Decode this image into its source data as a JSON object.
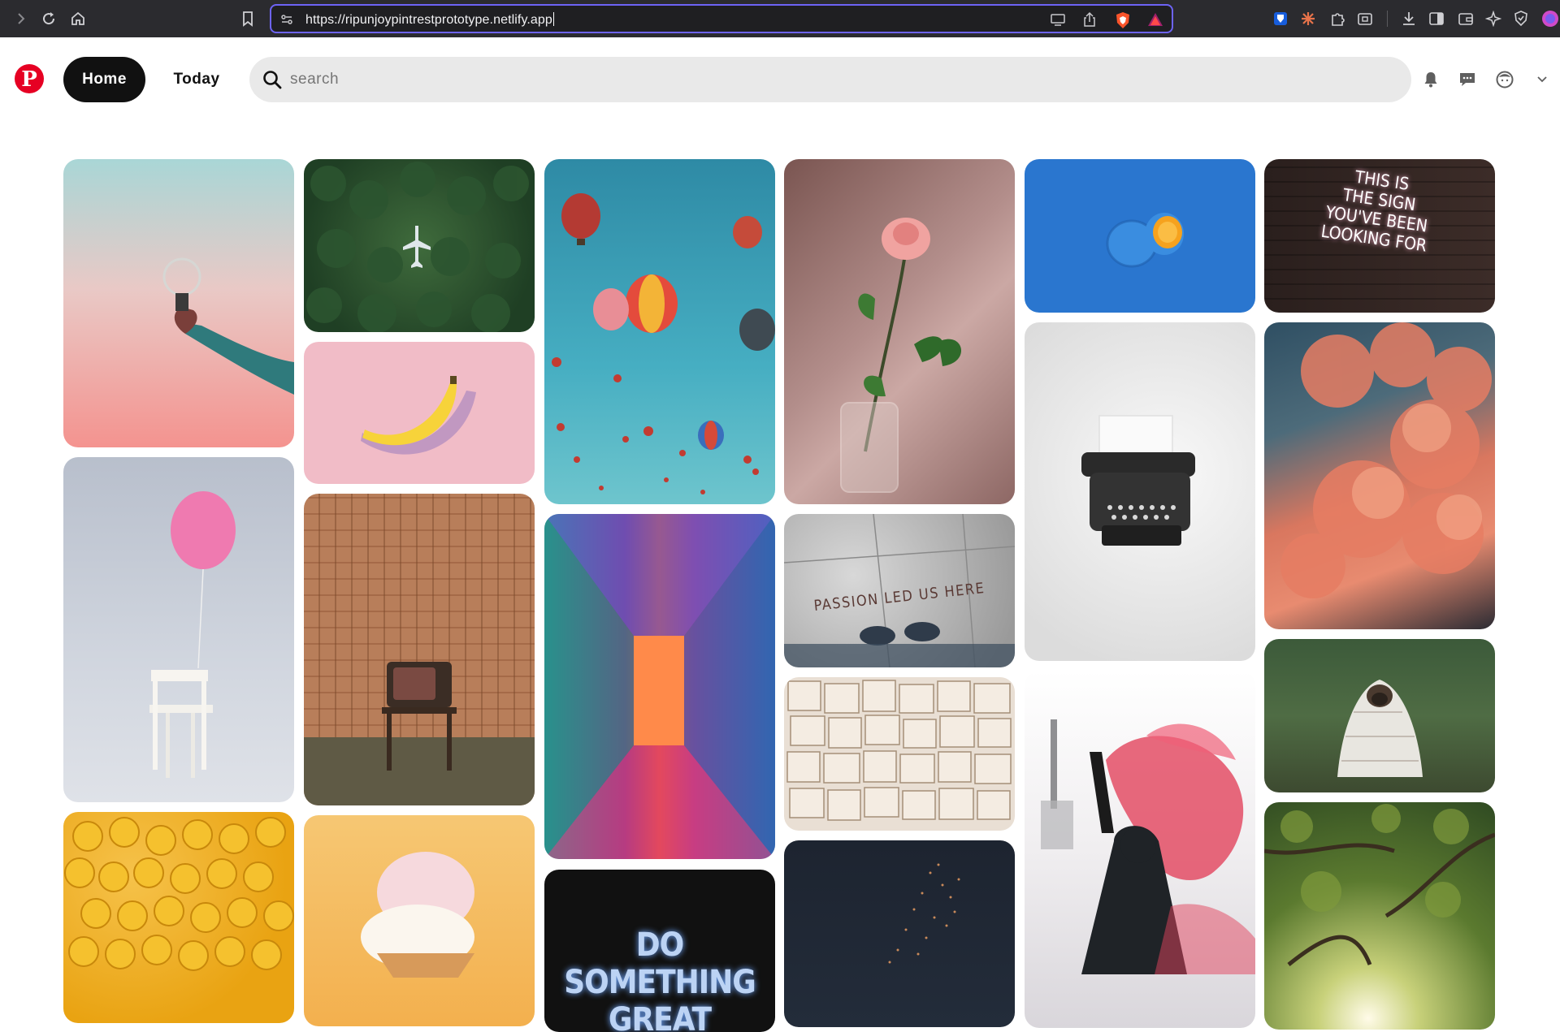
{
  "browser": {
    "url": "https://ripunjoypintrestprototype.netlify.app",
    "accent": "#6d63f5"
  },
  "header": {
    "logo_letter": "P",
    "logo_color": "#e60023",
    "home_label": "Home",
    "today_label": "Today",
    "search_placeholder": "search",
    "icons": [
      "bell-icon",
      "message-icon",
      "profile-icon",
      "chevron-down-icon"
    ]
  },
  "pins": [
    {
      "name": "pin-lightbulb"
    },
    {
      "name": "pin-forest-plane"
    },
    {
      "name": "pin-balloons"
    },
    {
      "name": "pin-rose"
    },
    {
      "name": "pin-blue-orange"
    },
    {
      "name": "pin-neon-sign",
      "text": "THIS IS\nTHE SIGN\nYOU'VE BEEN\nLOOKING FOR"
    },
    {
      "name": "pin-banana"
    },
    {
      "name": "pin-balloon-chair"
    },
    {
      "name": "pin-tv"
    },
    {
      "name": "pin-neon-corridor"
    },
    {
      "name": "pin-passion",
      "text": "PASSION LED US HERE"
    },
    {
      "name": "pin-typewriter"
    },
    {
      "name": "pin-clouds"
    },
    {
      "name": "pin-books"
    },
    {
      "name": "pin-pug"
    },
    {
      "name": "pin-lego-heads"
    },
    {
      "name": "pin-icecream"
    },
    {
      "name": "pin-do-something",
      "text": "DO SOMETHING GREAT"
    },
    {
      "name": "pin-dark-sky"
    },
    {
      "name": "pin-red-smoke"
    },
    {
      "name": "pin-tree-canopy"
    }
  ]
}
